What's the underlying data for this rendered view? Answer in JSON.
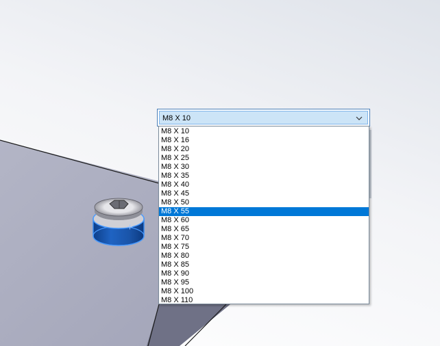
{
  "combo": {
    "value": "M8 X 10"
  },
  "list": {
    "items": [
      "M8 X 10",
      "M8 X 16",
      "M8 X 20",
      "M8 X 25",
      "M8 X 30",
      "M8 X 35",
      "M8 X 40",
      "M8 X 45",
      "M8 X 50",
      "M8 X 55",
      "M8 X 60",
      "M8 X 65",
      "M8 X 70",
      "M8 X 75",
      "M8 X 80",
      "M8 X 85",
      "M8 X 90",
      "M8 X 95",
      "M8 X 100",
      "M8 X 110"
    ],
    "selected_index": 9
  },
  "colors": {
    "selection": "#0078d7",
    "plate": "#a9abbd",
    "bolt_blue": "#1f5fb0",
    "bolt_highlight": "#3a8cf0"
  },
  "icons": {
    "dropdown": "chevron-down-icon"
  }
}
